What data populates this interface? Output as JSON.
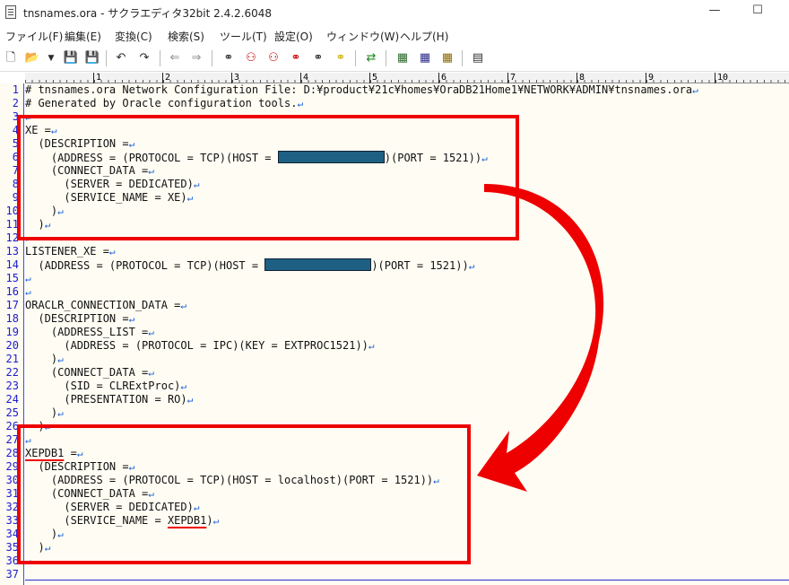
{
  "window": {
    "title": "tnsnames.ora - サクラエディタ32bit 2.4.2.6048",
    "minimize_icon": "minimize-icon",
    "maximize_icon": "maximize-icon"
  },
  "menu": [
    "ファイル(F)",
    "編集(E)",
    "変換(C)",
    "検索(S)",
    "ツール(T)",
    "設定(O)",
    "ウィンドウ(W)",
    "ヘルプ(H)"
  ],
  "toolbar_icons": [
    "new-file-icon",
    "open-folder-icon",
    "dropdown-arrow-icon",
    "save-icon",
    "save-all-icon",
    "undo-icon",
    "redo-icon",
    "jump-back-icon",
    "jump-forward-icon",
    "search-icon",
    "search-prev-icon",
    "search-next-icon",
    "replace-icon",
    "grep-icon",
    "highlight-icon",
    "outline-icon",
    "compare-icon",
    "settings-icon",
    "type-settings-icon",
    "window-list-icon"
  ],
  "ruler": [
    "1",
    "2",
    "3",
    "4",
    "5",
    "6",
    "7",
    "8",
    "9",
    "10"
  ],
  "editor": {
    "lines": [
      "# tnsnames.ora Network Configuration File: D:¥product¥21c¥homes¥OraDB21Home1¥NETWORK¥ADMIN¥tnsnames.ora",
      "# Generated by Oracle configuration tools.",
      "",
      "XE =",
      "  (DESCRIPTION =",
      "    (ADDRESS = (PROTOCOL = TCP)(HOST = ",
      "    (CONNECT_DATA =",
      "      (SERVER = DEDICATED)",
      "      (SERVICE_NAME = XE)",
      "    )",
      "  )",
      "",
      "LISTENER_XE =",
      "  (ADDRESS = (PROTOCOL = TCP)(HOST = ",
      "",
      "",
      "ORACLR_CONNECTION_DATA =",
      "  (DESCRIPTION =",
      "    (ADDRESS_LIST =",
      "      (ADDRESS = (PROTOCOL = IPC)(KEY = EXTPROC1521))",
      "    )",
      "    (CONNECT_DATA =",
      "      (SID = CLRExtProc)",
      "      (PRESENTATION = RO)",
      "    )",
      "  )",
      "",
      "XEPDB1",
      "  (DESCRIPTION =",
      "    (ADDRESS = (PROTOCOL = TCP)(HOST = localhost)(PORT = 1521))",
      "    (CONNECT_DATA =",
      "      (SERVER = DEDICATED)",
      "      (SERVICE_NAME = ",
      "    )",
      "  )",
      "",
      ""
    ],
    "line6_tail": ")(PORT = 1521))",
    "line14_tail": ")(PORT = 1521))",
    "line28_tail": " =",
    "line33_value": "XEPDB1",
    "line33_tail": ")",
    "eol_mark": "↵"
  },
  "colors": {
    "highlight": "#ee0000",
    "redaction": "#1e6083",
    "line_numbers": "#1c1cce"
  }
}
